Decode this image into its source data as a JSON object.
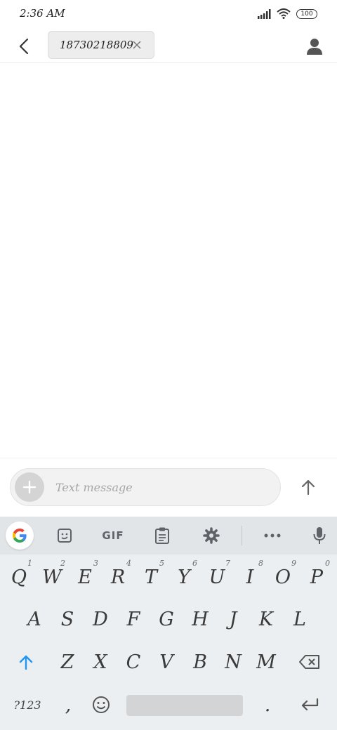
{
  "status_bar": {
    "time": "2:36 AM",
    "battery": "100",
    "icons": [
      "signal-icon",
      "wifi-icon",
      "battery-icon"
    ]
  },
  "header": {
    "back_icon": "back-arrow-icon",
    "recipient": "18730218809",
    "remove_icon": "close-icon",
    "contact_icon": "person-icon"
  },
  "compose": {
    "attach_icon": "plus-icon",
    "placeholder": "Text message",
    "send_icon": "arrow-up-icon"
  },
  "keyboard": {
    "toolbar": {
      "items": [
        "google-icon",
        "sticker-icon",
        "gif",
        "clipboard-icon",
        "settings-icon",
        "more-icon",
        "mic-icon"
      ],
      "gif_label": "GIF"
    },
    "row1": [
      {
        "key": "Q",
        "hint": "1"
      },
      {
        "key": "W",
        "hint": "2"
      },
      {
        "key": "E",
        "hint": "3"
      },
      {
        "key": "R",
        "hint": "4"
      },
      {
        "key": "T",
        "hint": "5"
      },
      {
        "key": "Y",
        "hint": "6"
      },
      {
        "key": "U",
        "hint": "7"
      },
      {
        "key": "I",
        "hint": "8"
      },
      {
        "key": "O",
        "hint": "9"
      },
      {
        "key": "P",
        "hint": "0"
      }
    ],
    "row2": [
      "A",
      "S",
      "D",
      "F",
      "G",
      "H",
      "J",
      "K",
      "L"
    ],
    "row3": [
      "Z",
      "X",
      "C",
      "V",
      "B",
      "N",
      "M"
    ],
    "bottom": {
      "symbols_label": "?123",
      "comma": ",",
      "period": ".",
      "emoji_icon": "emoji-icon",
      "enter_icon": "enter-icon",
      "shift_icon": "shift-icon",
      "backspace_icon": "backspace-icon"
    }
  },
  "colors": {
    "shift_active": "#2196f3",
    "keyboard_bg": "#eceff1",
    "toolbar_bg": "#e2e5e7"
  }
}
